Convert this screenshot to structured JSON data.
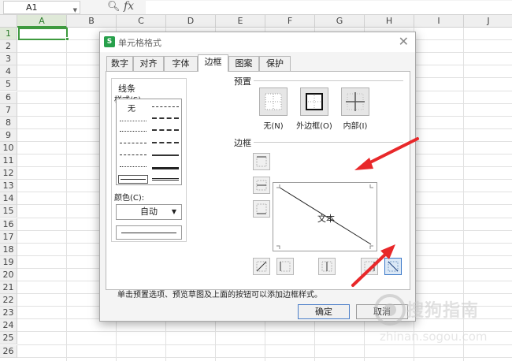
{
  "formula_bar": {
    "cell_ref": "A1",
    "fx_label": "fx"
  },
  "sheet": {
    "columns": [
      "A",
      "B",
      "C",
      "D",
      "E",
      "F",
      "G",
      "H",
      "I",
      "J"
    ],
    "rows": [
      "1",
      "2",
      "3",
      "4",
      "5",
      "6",
      "7",
      "8",
      "9",
      "10",
      "11",
      "12",
      "13",
      "14",
      "15",
      "16",
      "17",
      "18",
      "19",
      "20",
      "21",
      "22",
      "23",
      "24",
      "25",
      "26"
    ],
    "selected_column": "A",
    "selected_row": "1"
  },
  "dialog": {
    "title": "单元格格式",
    "tabs": [
      {
        "label": "数字"
      },
      {
        "label": "对齐"
      },
      {
        "label": "字体"
      },
      {
        "label": "边框"
      },
      {
        "label": "图案"
      },
      {
        "label": "保护"
      }
    ],
    "active_tab": "边框",
    "line_group": {
      "title": "线条",
      "style_label": "样式(S):",
      "none_label": "无",
      "color_label": "颜色(C):",
      "color_value": "自动"
    },
    "presets": {
      "title": "预置",
      "none": "无(N)",
      "outline": "外边框(O)",
      "inside": "内部(I)"
    },
    "border": {
      "title": "边框",
      "preview_text": "文本"
    },
    "hint": "单击预置选项、预览草图及上面的按钮可以添加边框样式。",
    "ok_label": "确定",
    "cancel_label": "取消"
  },
  "watermark": {
    "text": "搜狗指南",
    "url": "zhinan.sogou.com"
  },
  "colors": {
    "accent_green": "#3e9a3e",
    "annotation_red": "#e8282a",
    "app_icon": "#27a04b"
  }
}
